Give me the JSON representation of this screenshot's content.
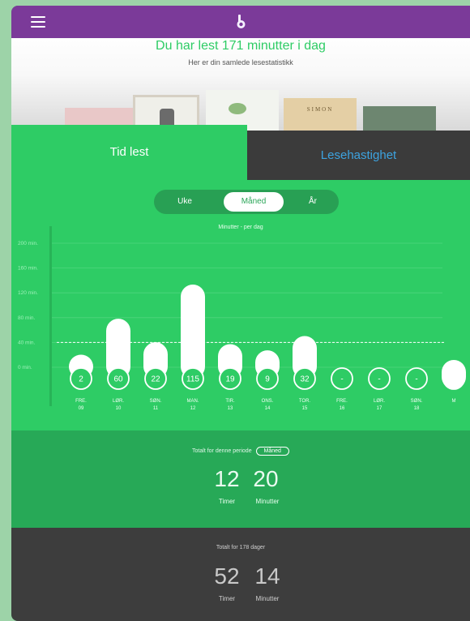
{
  "header": {
    "title": "Du har lest 171 minutter i dag",
    "subtitle": "Her er din samlede lesestatistikk",
    "book_text": "SIMON"
  },
  "tabs": [
    {
      "label": "Tid lest",
      "active": true
    },
    {
      "label": "Lesehastighet",
      "active": false
    }
  ],
  "period_selector": [
    {
      "label": "Uke",
      "active": false
    },
    {
      "label": "Måned",
      "active": true
    },
    {
      "label": "År",
      "active": false
    }
  ],
  "chart_data": {
    "type": "bar",
    "title": "Minutter - per dag",
    "y_tick_labels": [
      "200 min.",
      "160 min.",
      "120 min.",
      "80 min.",
      "40 min.",
      "0 min."
    ],
    "ylim": [
      0,
      200
    ],
    "average_line": 40,
    "days": [
      {
        "day": "FRE.",
        "date": "09",
        "label": "2",
        "value": 2
      },
      {
        "day": "LØR.",
        "date": "10",
        "label": "60",
        "value": 60
      },
      {
        "day": "SØN.",
        "date": "11",
        "label": "22",
        "value": 22
      },
      {
        "day": "MAN.",
        "date": "12",
        "label": "115",
        "value": 115
      },
      {
        "day": "TIR.",
        "date": "13",
        "label": "19",
        "value": 19
      },
      {
        "day": "ONS.",
        "date": "14",
        "label": "9",
        "value": 9
      },
      {
        "day": "TOR.",
        "date": "15",
        "label": "32",
        "value": 32
      },
      {
        "day": "FRE.",
        "date": "16",
        "label": "-",
        "value": 0
      },
      {
        "day": "LØR.",
        "date": "17",
        "label": "-",
        "value": 0
      },
      {
        "day": "SØN.",
        "date": "18",
        "label": "-",
        "value": 0
      },
      {
        "day": "M",
        "date": "",
        "label": "",
        "value": 0
      }
    ]
  },
  "period_total": {
    "label": "Totalt for denne periode",
    "chip": "Måned",
    "hours": "12",
    "minutes": "20",
    "hours_unit": "Timer",
    "minutes_unit": "Minutter"
  },
  "all_total": {
    "label": "Totalt for 178 dager",
    "hours": "52",
    "minutes": "14",
    "hours_unit": "Timer",
    "minutes_unit": "Minutter"
  },
  "colors": {
    "top_bar": "#7b3a99",
    "accent_green": "#2ecc65",
    "dark": "#3b3b3b",
    "speed_tab_text": "#3da3e0"
  },
  "icons": {
    "menu": "hamburger-menu-icon",
    "logo": "app-logo-icon"
  }
}
